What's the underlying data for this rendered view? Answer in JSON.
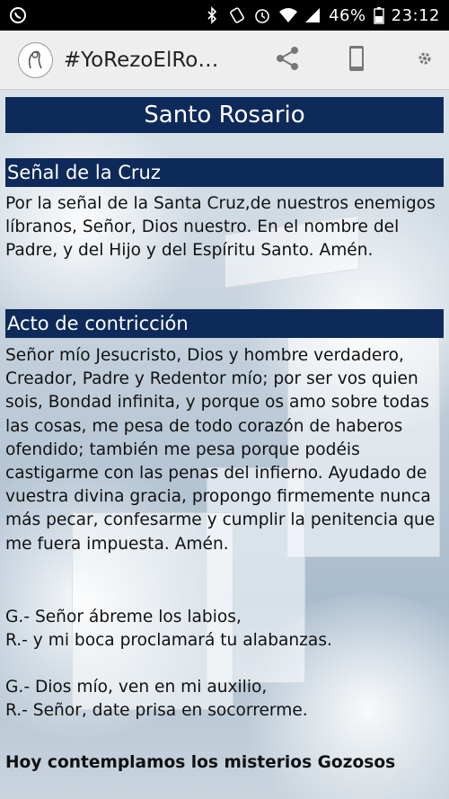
{
  "status_bar": {
    "battery": "46%",
    "time": "23:12",
    "icons": [
      "whatsapp-icon",
      "bluetooth-icon",
      "rotation-icon",
      "alarm-icon",
      "wifi-icon",
      "signal-icon",
      "battery-icon"
    ]
  },
  "action_bar": {
    "title": "#YoRezoElRosario",
    "icons": [
      "app-logo-icon",
      "share-icon",
      "phone-icon",
      "settings-icon"
    ]
  },
  "main": {
    "title": "Santo Rosario",
    "sections": [
      {
        "header": "Señal de la Cruz",
        "text": "Por la señal de la Santa Cruz,de nuestros enemigos líbranos, Señor, Dios nuestro. En el nombre del Padre, y del Hijo y del Espíritu Santo. Amén."
      },
      {
        "header": "Acto de contricción",
        "text": "Señor mío Jesucristo, Dios y hombre verdadero, Creador, Padre y Redentor mío; por ser vos quien sois, Bondad infinita, y porque os amo sobre todas las cosas, me pesa de todo corazón de haberos ofendido; también me pesa porque podéis castigarme con las penas del infierno. Ayudado de vuestra divina gracia, propongo firmemente nunca más pecar, confesarme y cumplir la penitencia que me fuera impuesta. Amén."
      }
    ],
    "versicles": [
      {
        "g": "G.- Señor ábreme los labios,",
        "r": "R.- y mi boca proclamará tu alabanzas."
      },
      {
        "g": "G.- Dios mío, ven en mi auxilio,",
        "r": "R.- Señor, date prisa en socorrerme."
      }
    ],
    "mysteries_line": "Hoy contemplamos los misterios Gozosos"
  },
  "colors": {
    "header_bg": "#0e2a5a",
    "header_text": "#ffffff",
    "action_bar_bg": "#eeeeee",
    "status_bar_bg": "#000000"
  }
}
